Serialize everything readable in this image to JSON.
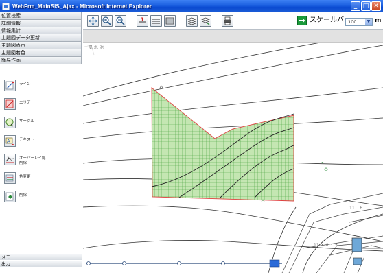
{
  "window": {
    "title": "WebFrm_MainSIS_Ajax - Microsoft Internet Explorer",
    "controls": [
      "minimize",
      "maximize",
      "close"
    ]
  },
  "sidebar": {
    "menu": [
      {
        "label": "位置検索"
      },
      {
        "label": "詳細情報"
      },
      {
        "label": "情報集計"
      },
      {
        "label": "主題図データ更新"
      },
      {
        "label": "主題図表示"
      },
      {
        "label": "主題図着色"
      },
      {
        "label": "簡易作画"
      }
    ],
    "tools": [
      {
        "label": "ライン",
        "icon": "line-draw-icon"
      },
      {
        "label": "エリア",
        "icon": "area-draw-icon"
      },
      {
        "label": "サークル",
        "icon": "circle-draw-icon"
      },
      {
        "label": "テキスト",
        "icon": "text-draw-icon"
      },
      {
        "label": "オーバーレイ線\n削除",
        "icon": "overlay-line-delete-icon"
      },
      {
        "label": "色変更",
        "icon": "color-change-icon"
      },
      {
        "label": "削除",
        "icon": "delete-icon"
      }
    ],
    "bottom": [
      {
        "label": "メモ"
      },
      {
        "label": "出力"
      }
    ]
  },
  "toolbar": {
    "buttons": [
      {
        "icon": "pan-icon"
      },
      {
        "icon": "zoom-in-icon"
      },
      {
        "icon": "zoom-out-icon"
      },
      {
        "icon": "measure-point-icon"
      },
      {
        "icon": "measure-line-icon"
      },
      {
        "icon": "measure-area-icon"
      },
      {
        "icon": "layers-icon"
      },
      {
        "icon": "layers-edit-icon"
      },
      {
        "icon": "print-icon"
      }
    ],
    "scale_label": "スケールバー",
    "scale_value": "100",
    "scale_unit": "m"
  },
  "map": {
    "labels": {
      "top_left": "瓜 水 池",
      "label_a": "11 .. 6",
      "label_b": "11 ・ 6 ・ 5"
    },
    "colors": {
      "area_fill": "#b8e2a6",
      "area_grid": "#43a63a",
      "area_border": "#e04040",
      "water": "#6ea8d8"
    }
  }
}
